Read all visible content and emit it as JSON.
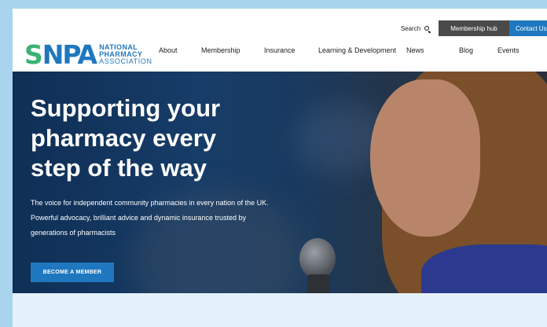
{
  "utility": {
    "search_label": "Search",
    "membership_hub": "Membership hub",
    "contact": "Contact Us"
  },
  "logo": {
    "letters": "NPA",
    "line1": "NATIONAL",
    "line2": "PHARMACY",
    "line3": "ASSOCIATION"
  },
  "nav": [
    "About",
    "Membership",
    "Insurance",
    "Learning & Development",
    "News",
    "Blog",
    "Events"
  ],
  "hero": {
    "heading": "Supporting your pharmacy every step of the way",
    "body": "The voice for independent community pharmacies in every nation of the UK. Powerful advocacy, brilliant advice and dynamic insurance trusted by generations of pharmacists",
    "cta": "BECOME A MEMBER"
  },
  "colors": {
    "brand_blue": "#1f78bf",
    "brand_green": "#3bb273",
    "hero_bg": "#163c68",
    "page_bg": "#a9d4ee"
  }
}
